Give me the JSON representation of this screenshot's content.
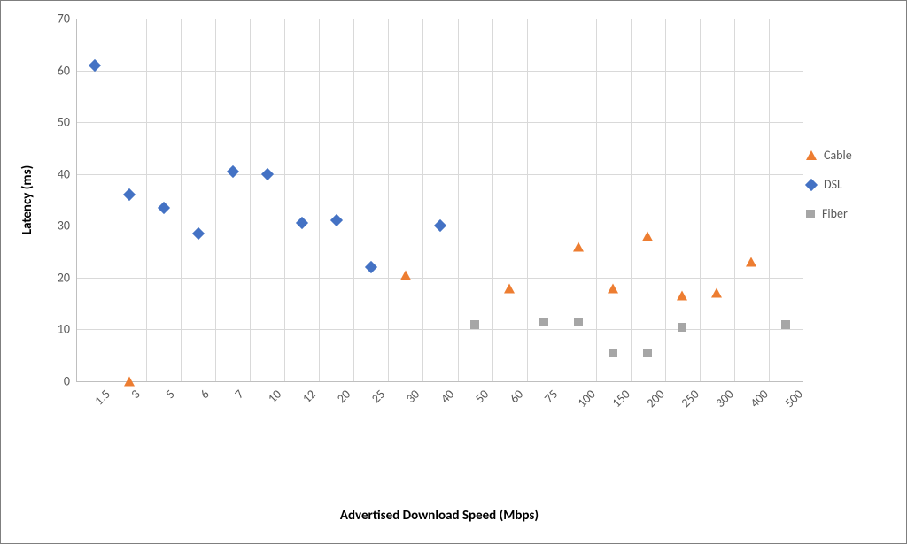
{
  "chart_data": {
    "type": "scatter",
    "title": "",
    "xlabel": "Advertised Download Speed (Mbps)",
    "ylabel": "Latency (ms)",
    "ylim": [
      0,
      70
    ],
    "x_categories": [
      "1.5",
      "3",
      "5",
      "6",
      "7",
      "10",
      "12",
      "20",
      "25",
      "30",
      "40",
      "50",
      "60",
      "75",
      "100",
      "150",
      "200",
      "250",
      "300",
      "400",
      "500"
    ],
    "series": [
      {
        "name": "Cable",
        "marker": "triangle",
        "color": "#ed7d31",
        "points": [
          {
            "x": "3",
            "y": 0
          },
          {
            "x": "30",
            "y": 20.5
          },
          {
            "x": "60",
            "y": 18
          },
          {
            "x": "100",
            "y": 26
          },
          {
            "x": "150",
            "y": 18
          },
          {
            "x": "200",
            "y": 28
          },
          {
            "x": "250",
            "y": 16.5
          },
          {
            "x": "300",
            "y": 17
          },
          {
            "x": "400",
            "y": 23
          }
        ]
      },
      {
        "name": "DSL",
        "marker": "diamond",
        "color": "#4472c4",
        "points": [
          {
            "x": "1.5",
            "y": 61
          },
          {
            "x": "3",
            "y": 36
          },
          {
            "x": "5",
            "y": 33.5
          },
          {
            "x": "6",
            "y": 28.5
          },
          {
            "x": "7",
            "y": 40.5
          },
          {
            "x": "10",
            "y": 40
          },
          {
            "x": "12",
            "y": 30.5
          },
          {
            "x": "20",
            "y": 31
          },
          {
            "x": "25",
            "y": 22
          },
          {
            "x": "40",
            "y": 30
          }
        ]
      },
      {
        "name": "Fiber",
        "marker": "square",
        "color": "#a6a6a6",
        "points": [
          {
            "x": "50",
            "y": 11
          },
          {
            "x": "75",
            "y": 11.5
          },
          {
            "x": "100",
            "y": 11.5
          },
          {
            "x": "150",
            "y": 5.5
          },
          {
            "x": "200",
            "y": 5.5
          },
          {
            "x": "250",
            "y": 10.5
          },
          {
            "x": "500",
            "y": 11
          }
        ]
      }
    ],
    "y_ticks": [
      0,
      10,
      20,
      30,
      40,
      50,
      60,
      70
    ]
  },
  "legend": {
    "cable": "Cable",
    "dsl": "DSL",
    "fiber": "Fiber"
  }
}
